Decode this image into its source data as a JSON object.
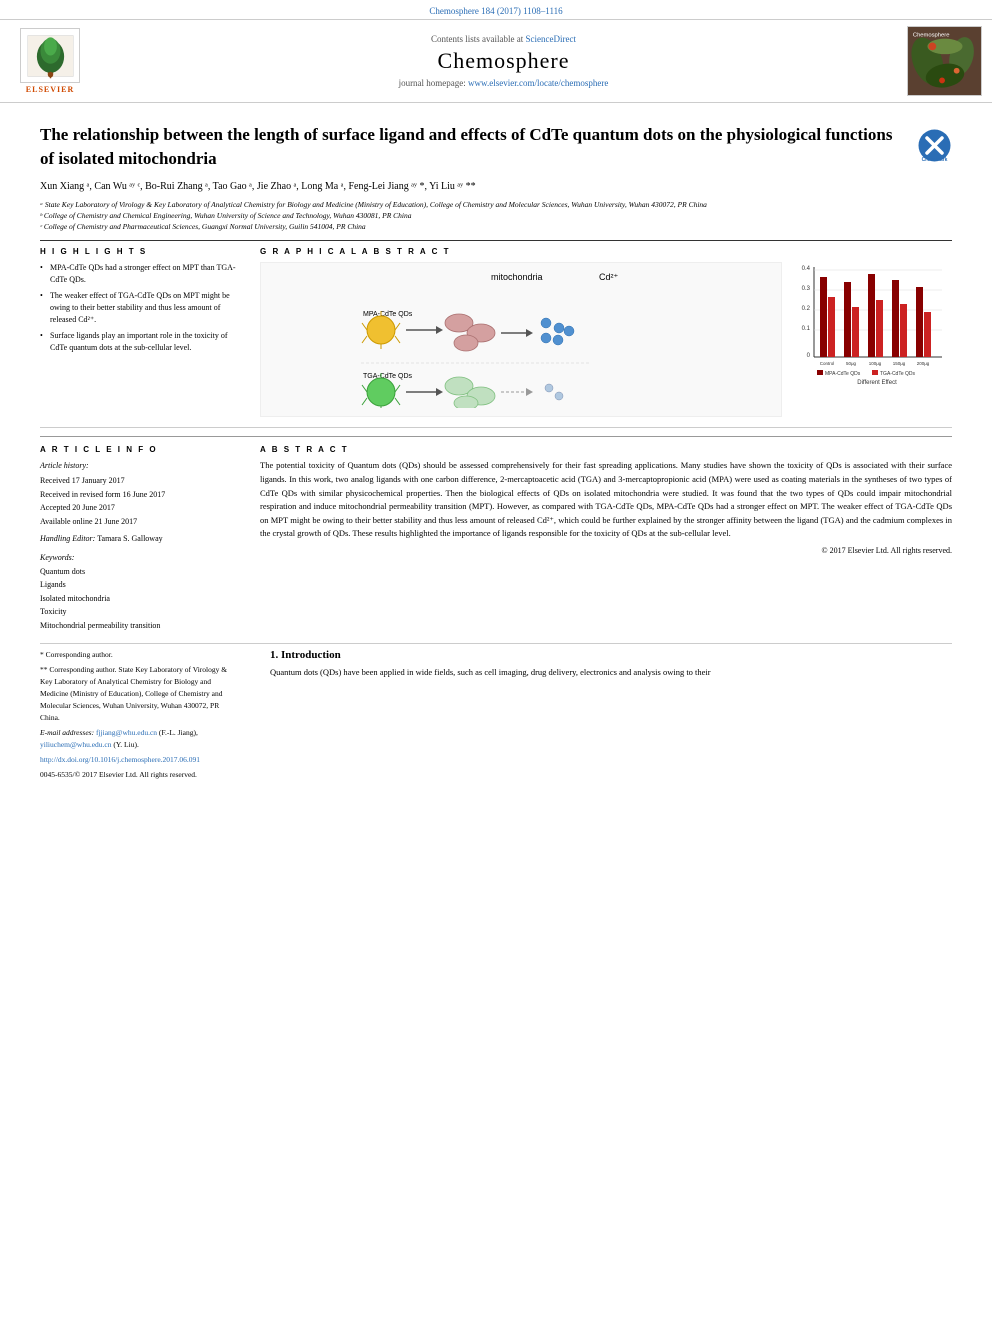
{
  "topBar": {
    "citation": "Chemosphere 184 (2017) 1108–1116"
  },
  "header": {
    "contentsLine": "Contents lists available at",
    "scienceDirect": "ScienceDirect",
    "journalTitle": "Chemosphere",
    "homepageLabel": "journal homepage:",
    "homepageUrl": "www.elsevier.com/locate/chemosphere",
    "elsevier": "ELSEVIER"
  },
  "article": {
    "title": "The relationship between the length of surface ligand and effects of CdTe quantum dots on the physiological functions of isolated mitochondria",
    "authors": "Xun Xiang ᵃ, Can Wu ᵃʸ ᶜ, Bo-Rui Zhang ᵃ, Tao Gao ᵃ, Jie Zhao ᵃ, Long Ma ᵃ, Feng-Lei Jiang ᵃʸ *, Yi Liu ᵃʸ **",
    "affiliation_a": "ᵃ State Key Laboratory of Virology & Key Laboratory of Analytical Chemistry for Biology and Medicine (Ministry of Education), College of Chemistry and Molecular Sciences, Wuhan University, Wuhan 430072, PR China",
    "affiliation_b": "ᵇ College of Chemistry and Chemical Engineering, Wuhan University of Science and Technology, Wuhan 430081, PR China",
    "affiliation_c": "ᶜ College of Chemistry and Pharmaceutical Sciences, Guangxi Normal University, Guilin 541004, PR China"
  },
  "highlights": {
    "heading": "H I G H L I G H T S",
    "items": [
      "MPA-CdTe QDs had a stronger effect on MPT than TGA-CdTe QDs.",
      "The weaker effect of TGA-CdTe QDs on MPT might be owing to their better stability and thus less amount of released Cd²⁺.",
      "Surface ligands play an important role in the toxicity of CdTe quantum dots at the sub-cellular level."
    ]
  },
  "graphicalAbstract": {
    "heading": "G R A P H I C A L   A B S T R A C T",
    "mpaLabel": "MPA-CdTe QDs",
    "tgaLabel": "TGA-CdTe QDs",
    "mitochondriaLabel": "mitochondria",
    "cd2Label": "Cd²⁺",
    "differentEffectLabel": "Different Effect",
    "chartYLabel": "0.4",
    "chartY2Label": "0.3",
    "chartY3Label": "0.2",
    "chartY4Label": "0.1"
  },
  "articleInfo": {
    "heading": "A R T I C L E   I N F O",
    "historyLabel": "Article history:",
    "received": "Received 17 January 2017",
    "receivedRevised": "Received in revised form 16 June 2017",
    "accepted": "Accepted 20 June 2017",
    "available": "Available online 21 June 2017",
    "handlingEditorLabel": "Handling Editor:",
    "handlingEditor": "Tamara S. Galloway",
    "keywordsLabel": "Keywords:",
    "keywords": [
      "Quantum dots",
      "Ligands",
      "Isolated mitochondria",
      "Toxicity",
      "Mitochondrial permeability transition"
    ]
  },
  "abstract": {
    "heading": "A B S T R A C T",
    "text": "The potential toxicity of Quantum dots (QDs) should be assessed comprehensively for their fast spreading applications. Many studies have shown the toxicity of QDs is associated with their surface ligands. In this work, two analog ligands with one carbon difference, 2-mercaptoacetic acid (TGA) and 3-mercaptopropionic acid (MPA) were used as coating materials in the syntheses of two types of CdTe QDs with similar physicochemical properties. Then the biological effects of QDs on isolated mitochondria were studied. It was found that the two types of QDs could impair mitochondrial respiration and induce mitochondrial permeability transition (MPT). However, as compared with TGA-CdTe QDs, MPA-CdTe QDs had a stronger effect on MPT. The weaker effect of TGA-CdTe QDs on MPT might be owing to their better stability and thus less amount of released Cd²⁺, which could be further explained by the stronger affinity between the ligand (TGA) and the cadmium complexes in the crystal growth of QDs. These results highlighted the importance of ligands responsible for the toxicity of QDs at the sub-cellular level.",
    "copyright": "© 2017 Elsevier Ltd. All rights reserved."
  },
  "footerNotes": {
    "corresponding1": "* Corresponding author.",
    "corresponding2": "** Corresponding author. State Key Laboratory of Virology & Key Laboratory of Analytical Chemistry for Biology and Medicine (Ministry of Education), College of Chemistry and Molecular Sciences, Wuhan University, Wuhan 430072, PR China.",
    "emailLabel": "E-mail addresses:",
    "email1": "fjjiang@whu.edu.cn",
    "emailName1": "(F.-L. Jiang),",
    "email2": "yiliuchem@whu.edu.cn",
    "emailName2": "(Y. Liu).",
    "doi": "http://dx.doi.org/10.1016/j.chemosphere.2017.06.091",
    "issn": "0045-6535/© 2017 Elsevier Ltd. All rights reserved."
  },
  "introduction": {
    "heading": "1. Introduction",
    "text": "Quantum dots (QDs) have been applied in wide fields, such as cell imaging, drug delivery, electronics and analysis owing to their"
  }
}
